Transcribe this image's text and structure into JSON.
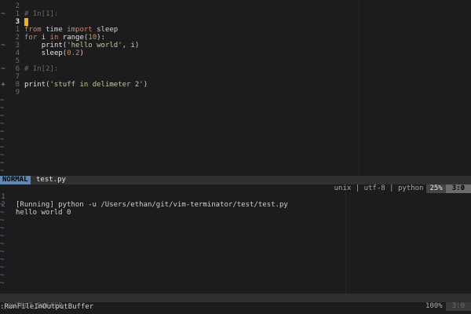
{
  "editor": {
    "lines": [
      {
        "n": "2",
        "g": "",
        "parts": []
      },
      {
        "n": "1",
        "g": "~",
        "parts": [
          [
            "cmt",
            "# In[1]:"
          ]
        ]
      },
      {
        "n": "3",
        "g": "",
        "cur": true,
        "cursor": true,
        "parts": []
      },
      {
        "n": "1",
        "g": "",
        "parts": [
          [
            "kw",
            "from"
          ],
          [
            "",
            "time"
          ],
          [
            "kw",
            "import"
          ],
          [
            "",
            "sleep"
          ]
        ],
        "sep": " "
      },
      {
        "n": "2",
        "g": "",
        "parts": [
          [
            "kw",
            "for "
          ],
          [
            "",
            "i "
          ],
          [
            "kw",
            "in "
          ],
          [
            "fn",
            "range"
          ],
          [
            "",
            "("
          ],
          [
            "numlit",
            "10"
          ],
          [
            "",
            "):"
          ]
        ]
      },
      {
        "n": "3",
        "g": "~",
        "parts": [
          [
            "",
            "    "
          ],
          [
            "fn",
            "print"
          ],
          [
            "",
            "("
          ],
          [
            "str",
            "'hello world'"
          ],
          [
            "",
            ", i)"
          ]
        ]
      },
      {
        "n": "4",
        "g": "",
        "parts": [
          [
            "",
            "    "
          ],
          [
            "fn",
            "sleep"
          ],
          [
            "",
            "("
          ],
          [
            "numlit",
            "0.2"
          ],
          [
            "",
            ")"
          ]
        ]
      },
      {
        "n": "5",
        "g": "",
        "parts": []
      },
      {
        "n": "6",
        "g": "~",
        "parts": [
          [
            "cmt",
            "# In[2]:"
          ]
        ]
      },
      {
        "n": "7",
        "g": "",
        "parts": []
      },
      {
        "n": "8",
        "g": "+",
        "parts": [
          [
            "fn",
            "print"
          ],
          [
            "",
            "("
          ],
          [
            "str",
            "'stuff in delimeter 2'"
          ],
          [
            "",
            ")"
          ]
        ]
      },
      {
        "n": "9",
        "g": "",
        "parts": []
      }
    ],
    "tilde_char": "~"
  },
  "status_top": {
    "mode": "NORMAL",
    "filename": "test.py",
    "fileformat": "unix",
    "encoding": "utf-8",
    "filetype": "python",
    "sep": "|",
    "percent": "25%",
    "position": "3:0"
  },
  "output": {
    "running_line": "[Running] python -u /Users/ethan/git/vim-terminator/test/test.py",
    "hello_line": "hello world 0",
    "num1": "1",
    "num2": "2"
  },
  "status_bottom": {
    "buffer_name": "_OUTPUT_BUFFER_",
    "percent": "100%",
    "position": "3:0"
  },
  "command_line": ":RunFileInOutputBuffer",
  "colors": {
    "background": "#1c1c1c",
    "mode_bg": "#5f87af",
    "cursor": "#ffaf00",
    "string": "#afd787",
    "keyword": "#d7875f"
  }
}
